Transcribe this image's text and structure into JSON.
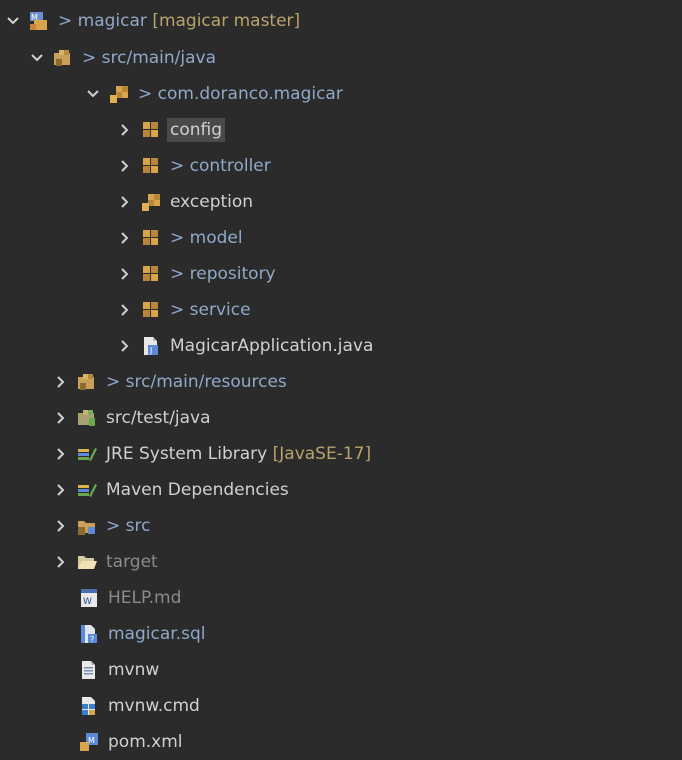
{
  "tree": {
    "rows": [
      {
        "label": "magicar",
        "decoration": "[magicar master]",
        "changed": true
      },
      {
        "label": "src/main/java",
        "changed": true
      },
      {
        "label": "com.doranco.magicar",
        "changed": true
      },
      {
        "label": "config"
      },
      {
        "label": "controller",
        "changed": true
      },
      {
        "label": "exception"
      },
      {
        "label": "model",
        "changed": true
      },
      {
        "label": "repository",
        "changed": true
      },
      {
        "label": "service",
        "changed": true
      },
      {
        "label": "MagicarApplication.java"
      },
      {
        "label": "src/main/resources",
        "changed": true
      },
      {
        "label": "src/test/java"
      },
      {
        "label": "JRE System Library",
        "decoration": "[JavaSE-17]"
      },
      {
        "label": "Maven Dependencies"
      },
      {
        "label": "src",
        "changed": true
      },
      {
        "label": "target"
      },
      {
        "label": "HELP.md"
      },
      {
        "label": "magicar.sql"
      },
      {
        "label": "mvnw"
      },
      {
        "label": "mvnw.cmd"
      },
      {
        "label": "pom.xml"
      }
    ],
    "change_marker": ">"
  },
  "icons": {
    "project": "maven-project-icon",
    "source_folder": "source-folder-icon",
    "package": "package-icon",
    "java_file": "java-file-icon",
    "library": "library-icon",
    "folder": "folder-icon",
    "markdown_file": "word-file-icon",
    "sql_file": "sql-file-icon",
    "script_file": "text-file-icon",
    "cmd_file": "cmd-file-icon",
    "xml_file": "maven-pom-icon"
  },
  "colors": {
    "background": "#2b2b2b",
    "text": "#d0d0d0",
    "changed_text": "#8fa9c9",
    "decoration_text": "#b9a36a",
    "muted_text": "#8b8b8b",
    "selection": "#4a4a4a"
  }
}
